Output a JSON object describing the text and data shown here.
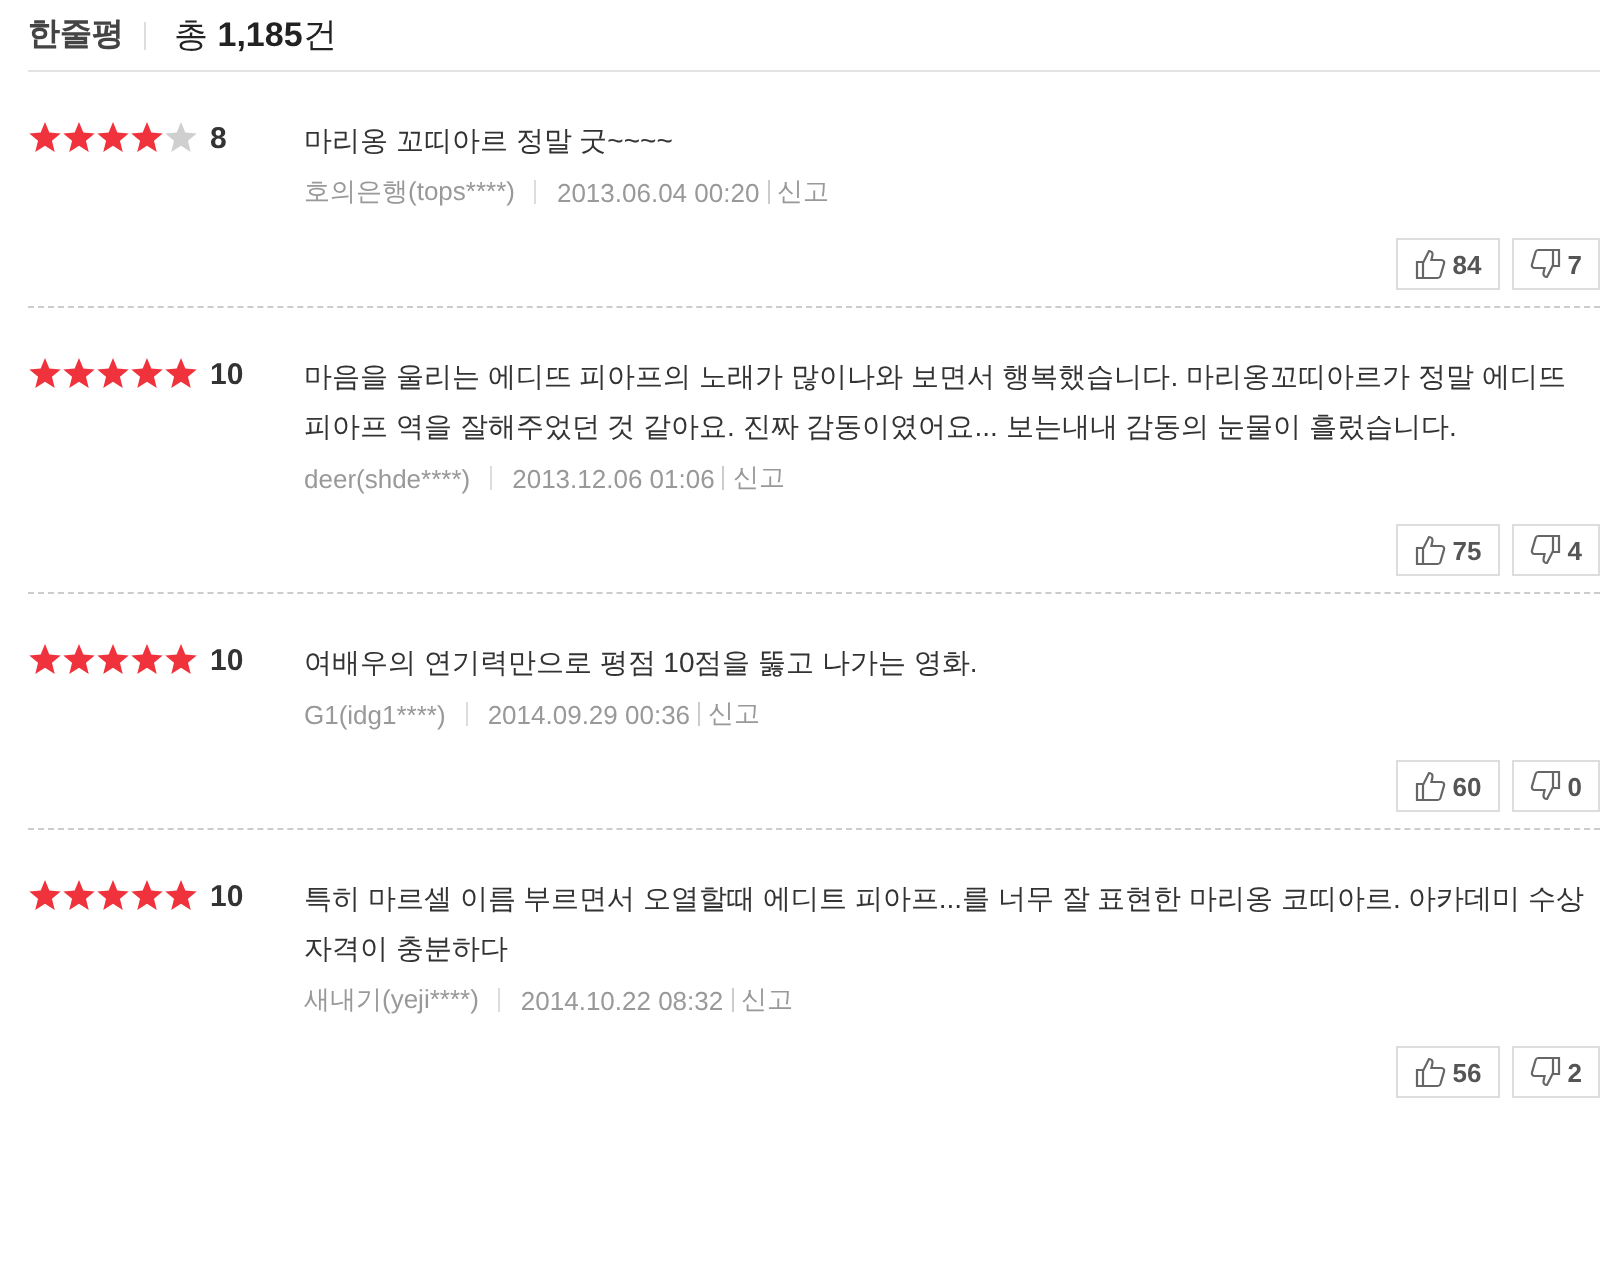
{
  "header": {
    "title": "한줄평",
    "total_prefix": "총",
    "total_count": "1,185",
    "total_suffix": "건"
  },
  "reviews": [
    {
      "stars": 4,
      "score": "8",
      "text": "마리옹 꼬띠아르 정말 굿~~~~",
      "author": "호의은행(tops****)",
      "date": "2013.06.04 00:20",
      "report": "신고",
      "likes": "84",
      "dislikes": "7"
    },
    {
      "stars": 5,
      "score": "10",
      "text": "마음을 울리는 에디뜨 피아프의 노래가 많이나와 보면서 행복했습니다. 마리옹꼬띠아르가 정말 에디뜨 피아프 역을 잘해주었던 것 같아요. 진짜 감동이였어요... 보는내내 감동의 눈물이 흘렀습니다.",
      "author": "deer(shde****)",
      "date": "2013.12.06 01:06",
      "report": "신고",
      "likes": "75",
      "dislikes": "4"
    },
    {
      "stars": 5,
      "score": "10",
      "text": "여배우의 연기력만으로 평점 10점을 뚫고 나가는 영화.",
      "author": "G1(idg1****)",
      "date": "2014.09.29 00:36",
      "report": "신고",
      "likes": "60",
      "dislikes": "0"
    },
    {
      "stars": 5,
      "score": "10",
      "text": "특히 마르셀 이름 부르면서 오열할때 에디트 피아프...를 너무 잘 표현한 마리옹 코띠아르. 아카데미 수상 자격이 충분하다",
      "author": "새내기(yeji****)",
      "date": "2014.10.22 08:32",
      "report": "신고",
      "likes": "56",
      "dislikes": "2"
    }
  ]
}
